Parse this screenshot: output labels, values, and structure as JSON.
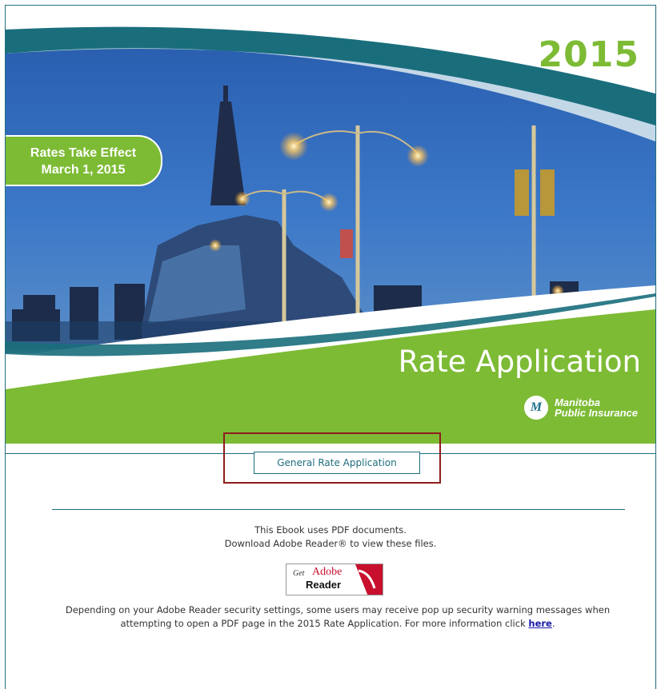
{
  "hero": {
    "year": "2015",
    "badge_line1": "Rates Take Effect",
    "badge_line2": "March 1, 2015",
    "title": "Rate Application",
    "logo_line1": "Manitoba",
    "logo_line2": "Public Insurance",
    "logo_mark": "M"
  },
  "nav": {
    "button_label": "General Rate Application"
  },
  "info": {
    "line1": "This Ebook uses PDF documents.",
    "line2": "Download Adobe Reader® to view these files."
  },
  "adobe": {
    "get": "Get",
    "brand": "Adobe",
    "reader": "Reader"
  },
  "notice": {
    "text": "Depending on your Adobe Reader security settings, some users may receive pop up security warning messages when attempting to open a PDF page in the 2015 Rate Application. For more information click ",
    "link": "here",
    "end": "."
  },
  "colors": {
    "green": "#7dbb35",
    "teal": "#1f6e7e",
    "highlight": "#8f1c1c"
  }
}
